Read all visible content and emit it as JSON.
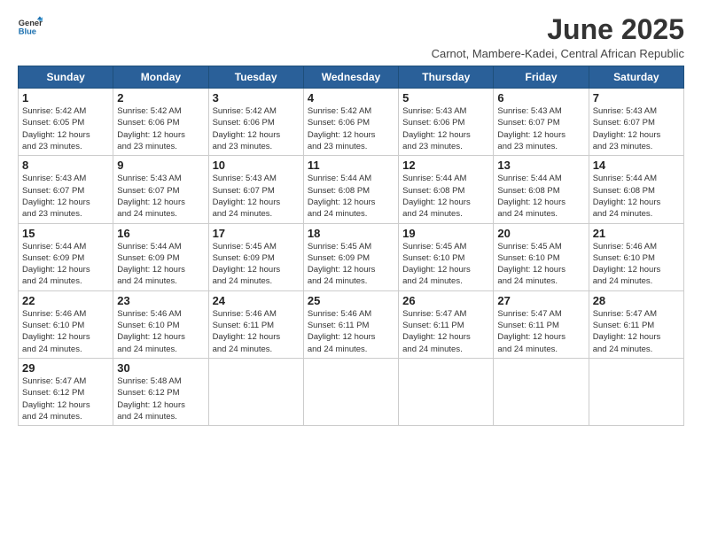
{
  "header": {
    "logo_general": "General",
    "logo_blue": "Blue",
    "title": "June 2025",
    "subtitle": "Carnot, Mambere-Kadei, Central African Republic"
  },
  "weekdays": [
    "Sunday",
    "Monday",
    "Tuesday",
    "Wednesday",
    "Thursday",
    "Friday",
    "Saturday"
  ],
  "weeks": [
    [
      {
        "day": "1",
        "info": "Sunrise: 5:42 AM\nSunset: 6:05 PM\nDaylight: 12 hours\nand 23 minutes."
      },
      {
        "day": "2",
        "info": "Sunrise: 5:42 AM\nSunset: 6:06 PM\nDaylight: 12 hours\nand 23 minutes."
      },
      {
        "day": "3",
        "info": "Sunrise: 5:42 AM\nSunset: 6:06 PM\nDaylight: 12 hours\nand 23 minutes."
      },
      {
        "day": "4",
        "info": "Sunrise: 5:42 AM\nSunset: 6:06 PM\nDaylight: 12 hours\nand 23 minutes."
      },
      {
        "day": "5",
        "info": "Sunrise: 5:43 AM\nSunset: 6:06 PM\nDaylight: 12 hours\nand 23 minutes."
      },
      {
        "day": "6",
        "info": "Sunrise: 5:43 AM\nSunset: 6:07 PM\nDaylight: 12 hours\nand 23 minutes."
      },
      {
        "day": "7",
        "info": "Sunrise: 5:43 AM\nSunset: 6:07 PM\nDaylight: 12 hours\nand 23 minutes."
      }
    ],
    [
      {
        "day": "8",
        "info": "Sunrise: 5:43 AM\nSunset: 6:07 PM\nDaylight: 12 hours\nand 23 minutes."
      },
      {
        "day": "9",
        "info": "Sunrise: 5:43 AM\nSunset: 6:07 PM\nDaylight: 12 hours\nand 24 minutes."
      },
      {
        "day": "10",
        "info": "Sunrise: 5:43 AM\nSunset: 6:07 PM\nDaylight: 12 hours\nand 24 minutes."
      },
      {
        "day": "11",
        "info": "Sunrise: 5:44 AM\nSunset: 6:08 PM\nDaylight: 12 hours\nand 24 minutes."
      },
      {
        "day": "12",
        "info": "Sunrise: 5:44 AM\nSunset: 6:08 PM\nDaylight: 12 hours\nand 24 minutes."
      },
      {
        "day": "13",
        "info": "Sunrise: 5:44 AM\nSunset: 6:08 PM\nDaylight: 12 hours\nand 24 minutes."
      },
      {
        "day": "14",
        "info": "Sunrise: 5:44 AM\nSunset: 6:08 PM\nDaylight: 12 hours\nand 24 minutes."
      }
    ],
    [
      {
        "day": "15",
        "info": "Sunrise: 5:44 AM\nSunset: 6:09 PM\nDaylight: 12 hours\nand 24 minutes."
      },
      {
        "day": "16",
        "info": "Sunrise: 5:44 AM\nSunset: 6:09 PM\nDaylight: 12 hours\nand 24 minutes."
      },
      {
        "day": "17",
        "info": "Sunrise: 5:45 AM\nSunset: 6:09 PM\nDaylight: 12 hours\nand 24 minutes."
      },
      {
        "day": "18",
        "info": "Sunrise: 5:45 AM\nSunset: 6:09 PM\nDaylight: 12 hours\nand 24 minutes."
      },
      {
        "day": "19",
        "info": "Sunrise: 5:45 AM\nSunset: 6:10 PM\nDaylight: 12 hours\nand 24 minutes."
      },
      {
        "day": "20",
        "info": "Sunrise: 5:45 AM\nSunset: 6:10 PM\nDaylight: 12 hours\nand 24 minutes."
      },
      {
        "day": "21",
        "info": "Sunrise: 5:46 AM\nSunset: 6:10 PM\nDaylight: 12 hours\nand 24 minutes."
      }
    ],
    [
      {
        "day": "22",
        "info": "Sunrise: 5:46 AM\nSunset: 6:10 PM\nDaylight: 12 hours\nand 24 minutes."
      },
      {
        "day": "23",
        "info": "Sunrise: 5:46 AM\nSunset: 6:10 PM\nDaylight: 12 hours\nand 24 minutes."
      },
      {
        "day": "24",
        "info": "Sunrise: 5:46 AM\nSunset: 6:11 PM\nDaylight: 12 hours\nand 24 minutes."
      },
      {
        "day": "25",
        "info": "Sunrise: 5:46 AM\nSunset: 6:11 PM\nDaylight: 12 hours\nand 24 minutes."
      },
      {
        "day": "26",
        "info": "Sunrise: 5:47 AM\nSunset: 6:11 PM\nDaylight: 12 hours\nand 24 minutes."
      },
      {
        "day": "27",
        "info": "Sunrise: 5:47 AM\nSunset: 6:11 PM\nDaylight: 12 hours\nand 24 minutes."
      },
      {
        "day": "28",
        "info": "Sunrise: 5:47 AM\nSunset: 6:11 PM\nDaylight: 12 hours\nand 24 minutes."
      }
    ],
    [
      {
        "day": "29",
        "info": "Sunrise: 5:47 AM\nSunset: 6:12 PM\nDaylight: 12 hours\nand 24 minutes."
      },
      {
        "day": "30",
        "info": "Sunrise: 5:48 AM\nSunset: 6:12 PM\nDaylight: 12 hours\nand 24 minutes."
      },
      null,
      null,
      null,
      null,
      null
    ]
  ]
}
